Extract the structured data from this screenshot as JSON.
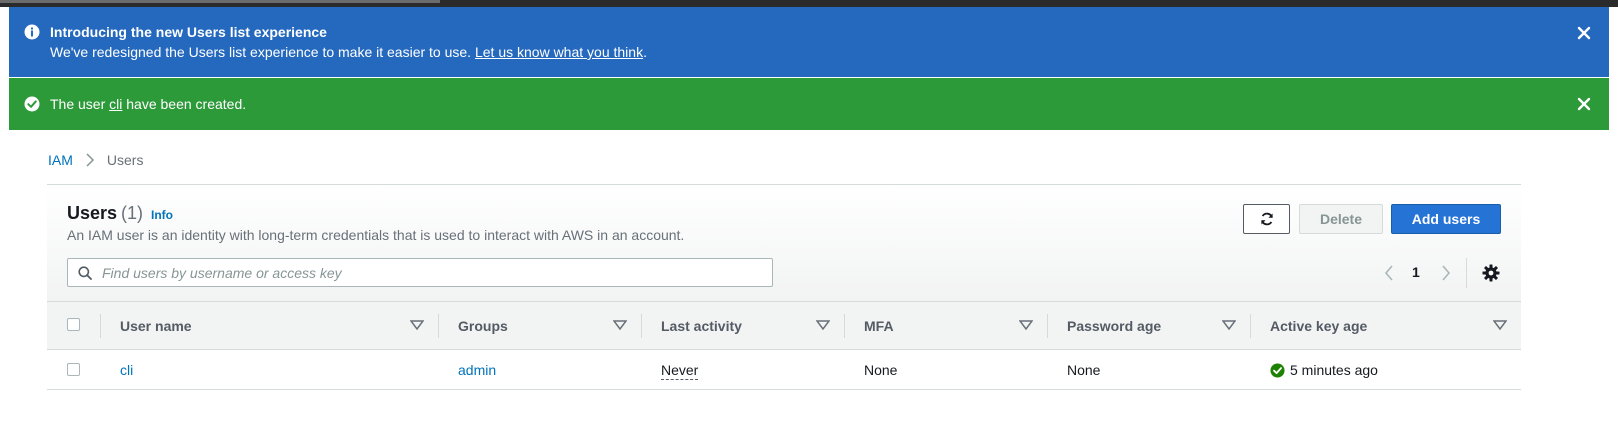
{
  "flash_info": {
    "title": "Introducing the new Users list experience",
    "body": "We've redesigned the Users list experience to make it easier to use.",
    "link": "Let us know what you think",
    "period": "."
  },
  "flash_success": {
    "prefix": "The user ",
    "user": "cli",
    "suffix": " have been created."
  },
  "breadcrumb": {
    "root": "IAM",
    "current": "Users"
  },
  "users_panel": {
    "title": "Users",
    "count": "(1)",
    "info": "Info",
    "description": "An IAM user is an identity with long-term credentials that is used to interact with AWS in an account.",
    "buttons": {
      "delete": "Delete",
      "add": "Add users"
    },
    "search_placeholder": "Find users by username or access key",
    "page": "1"
  },
  "table": {
    "columns": [
      "User name",
      "Groups",
      "Last activity",
      "MFA",
      "Password age",
      "Active key age"
    ],
    "rows": [
      {
        "user": "cli",
        "groups": "admin",
        "last_activity": "Never",
        "mfa": "None",
        "password_age": "None",
        "key_age": "5 minutes ago"
      }
    ]
  },
  "colors": {
    "info_banner": "#2469be",
    "success_banner": "#2d9a3a",
    "link": "#0073bb",
    "primary_button": "#2673d6"
  },
  "icons": [
    "info-icon",
    "close-icon",
    "check-circle-icon",
    "chevron-right-icon",
    "refresh-icon",
    "search-icon",
    "chevron-left-icon",
    "gear-icon",
    "sort-caret-icon"
  ]
}
